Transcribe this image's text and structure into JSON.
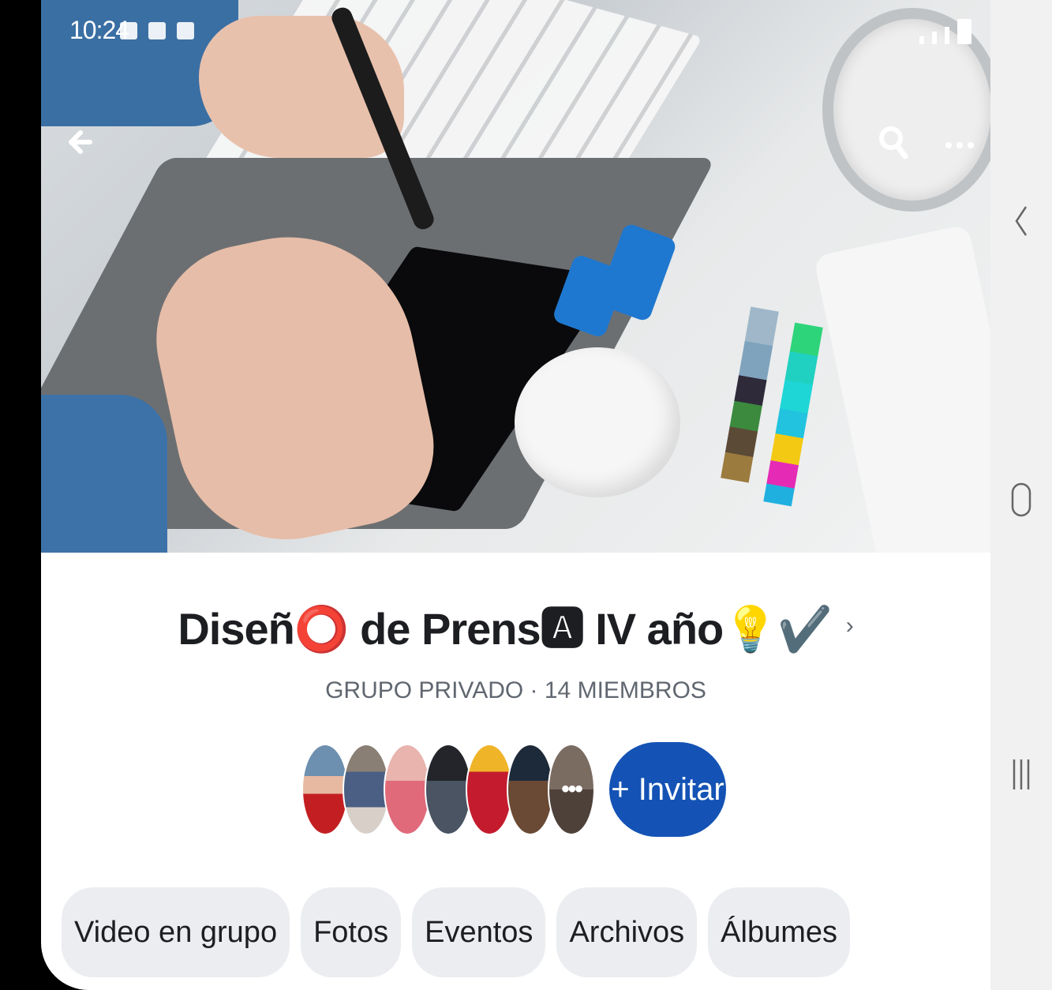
{
  "status_bar": {
    "time": "10:24"
  },
  "group": {
    "title": "Diseñ⭕ de Prens🅰 IV año💡✔️",
    "meta": "GRUPO PRIVADO · 14 MIEMBROS",
    "invite_label": "+ Invitar",
    "more_members_glyph": "•••"
  },
  "tabs": [
    "Video en grupo",
    "Fotos",
    "Eventos",
    "Archivos",
    "Álbumes"
  ],
  "icons": {
    "back": "back-arrow-icon",
    "search": "search-icon",
    "more": "more-dots-icon",
    "nav_back": "chevron-left-icon",
    "nav_home": "home-circle-icon",
    "nav_recents": "recents-lines-icon"
  },
  "colors": {
    "accent": "#1453b5",
    "chip_bg": "#ebedf0",
    "text": "#1c1e21",
    "muted": "#606770"
  }
}
